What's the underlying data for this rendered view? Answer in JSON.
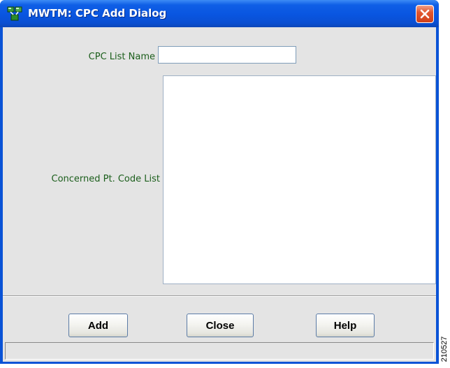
{
  "window": {
    "title": "MWTM: CPC Add Dialog",
    "app_icon": "network-app-icon",
    "close_icon": "close-x-icon"
  },
  "form": {
    "cpc_list_name_label": "CPC List Name",
    "cpc_list_name_value": "",
    "concerned_pt_code_label": "Concerned Pt. Code List",
    "concerned_pt_code_value": ""
  },
  "buttons": {
    "add": "Add",
    "close": "Close",
    "help": "Help"
  },
  "status_bar": {
    "text": ""
  },
  "figure_id": "210527",
  "colors": {
    "titlebar": "#0955e0",
    "client_background": "#e4e4e4",
    "label_text": "#1b5e1b",
    "close_button": "#e2562e"
  }
}
